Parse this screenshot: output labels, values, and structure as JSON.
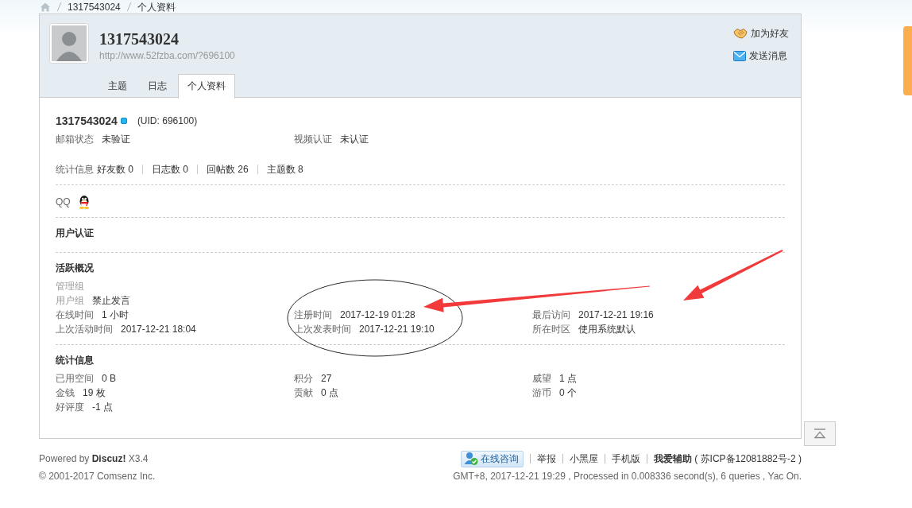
{
  "breadcrumb": {
    "items": [
      {
        "label": "1317543024"
      },
      {
        "label": "个人资料"
      }
    ]
  },
  "profile_header": {
    "name": "1317543024",
    "url": "http://www.52fzba.com/?696100",
    "actions": [
      {
        "kind": "add_friend",
        "label": "加为好友"
      },
      {
        "kind": "send_message",
        "label": "发送消息"
      }
    ]
  },
  "tabs": [
    {
      "label": "主题",
      "selected": false
    },
    {
      "label": "日志",
      "selected": false
    },
    {
      "label": "个人资料",
      "selected": true
    }
  ],
  "profile": {
    "username": "1317543024",
    "uid": "(UID: 696100)",
    "fields": [
      {
        "label": "邮箱状态",
        "value": "未验证"
      },
      {
        "label": "视频认证",
        "value": "未认证"
      }
    ],
    "stats": {
      "label": "统计信息",
      "items": [
        "好友数 0",
        "日志数 0",
        "回帖数 26",
        "主题数 8"
      ]
    },
    "qq": {
      "label": "QQ"
    }
  },
  "sections": [
    {
      "title": "用户认证"
    },
    {
      "title": "活跃概况",
      "groups": [
        {
          "label": "管理组"
        },
        {
          "label": "用户组",
          "value": "禁止发言"
        }
      ],
      "fields": [
        {
          "label": "在线时间",
          "value": "1 小时"
        },
        {
          "label": "注册时间",
          "value": "2017-12-19 01:28"
        },
        {
          "label": "最后访问",
          "value": "2017-12-21 19:16"
        },
        {
          "label": "上次活动时间",
          "value": "2017-12-21 18:04"
        },
        {
          "label": "上次发表时间",
          "value": "2017-12-21 19:10"
        },
        {
          "label": "所在时区",
          "value": "使用系统默认"
        }
      ]
    },
    {
      "title": "统计信息",
      "fields": [
        {
          "label": "已用空间",
          "value": "0 B"
        },
        {
          "label": "积分",
          "value": "27"
        },
        {
          "label": "威望",
          "value": "1 点"
        },
        {
          "label": "金钱",
          "value": "19 枚"
        },
        {
          "label": "贡献",
          "value": "0 点"
        },
        {
          "label": "游币",
          "value": "0 个"
        },
        {
          "label": "好评度",
          "value": "-1 点"
        }
      ]
    }
  ],
  "footer": {
    "powered": "Powered by **Discuz!** X3.4",
    "copyright": "© 2001-2017 Comsenz Inc.",
    "consult_button": "在线咨询",
    "links": [
      "举报",
      "小黑屋",
      "手机版"
    ],
    "site_name": "我爱辅助",
    "icp": "( 苏ICP备12081882号-2 )",
    "status": "GMT+8, 2017-12-21 19:29 , Processed in 0.008336 second(s), 6 queries , Yac On."
  }
}
